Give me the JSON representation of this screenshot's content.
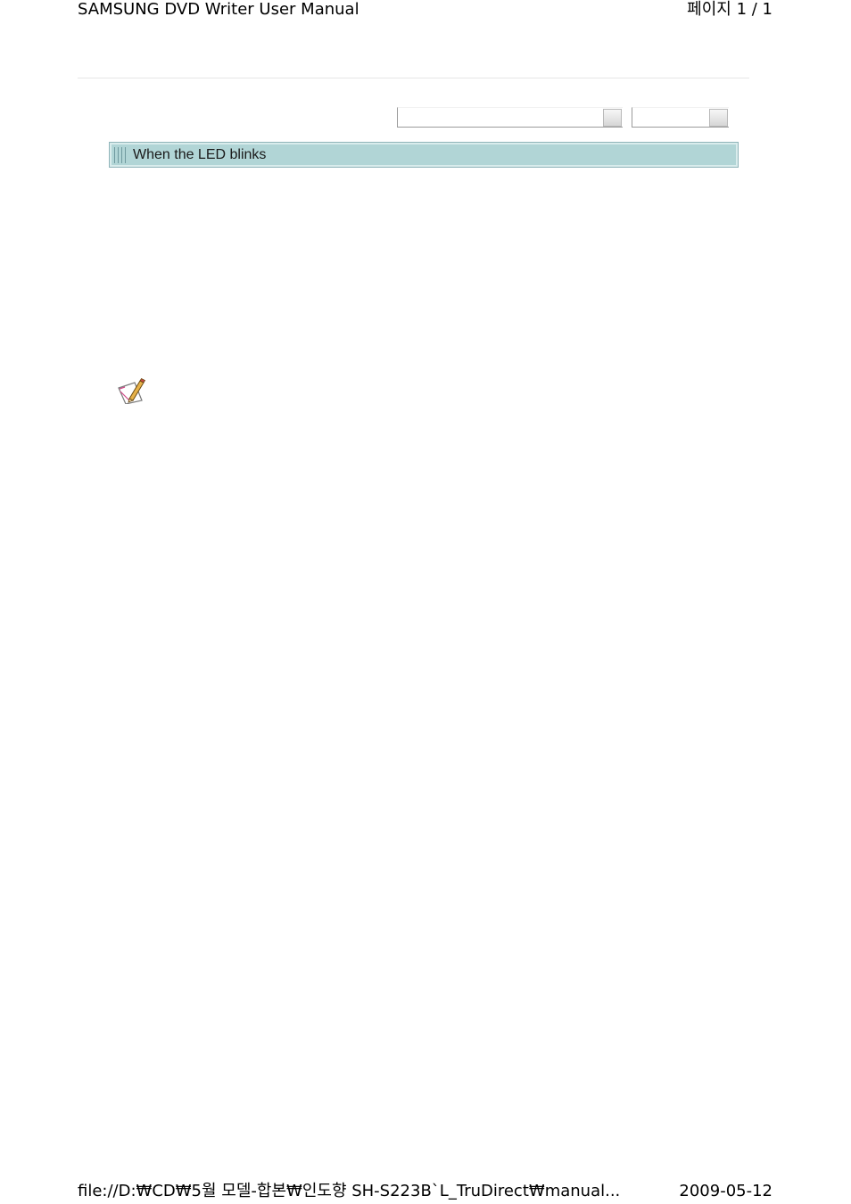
{
  "header": {
    "title": "SAMSUNG DVD Writer User Manual",
    "page_indicator": "페이지 1 / 1"
  },
  "toolbar": {
    "select_1_value": "",
    "select_2_value": ""
  },
  "section": {
    "title": "When the LED blinks"
  },
  "note": {
    "icon": "note-pencil-icon"
  },
  "footer": {
    "path": "file://D:₩CD₩5월 모델-합본₩인도향 SH-S223B`L_TruDirect₩manual...",
    "date": "2009-05-12"
  }
}
